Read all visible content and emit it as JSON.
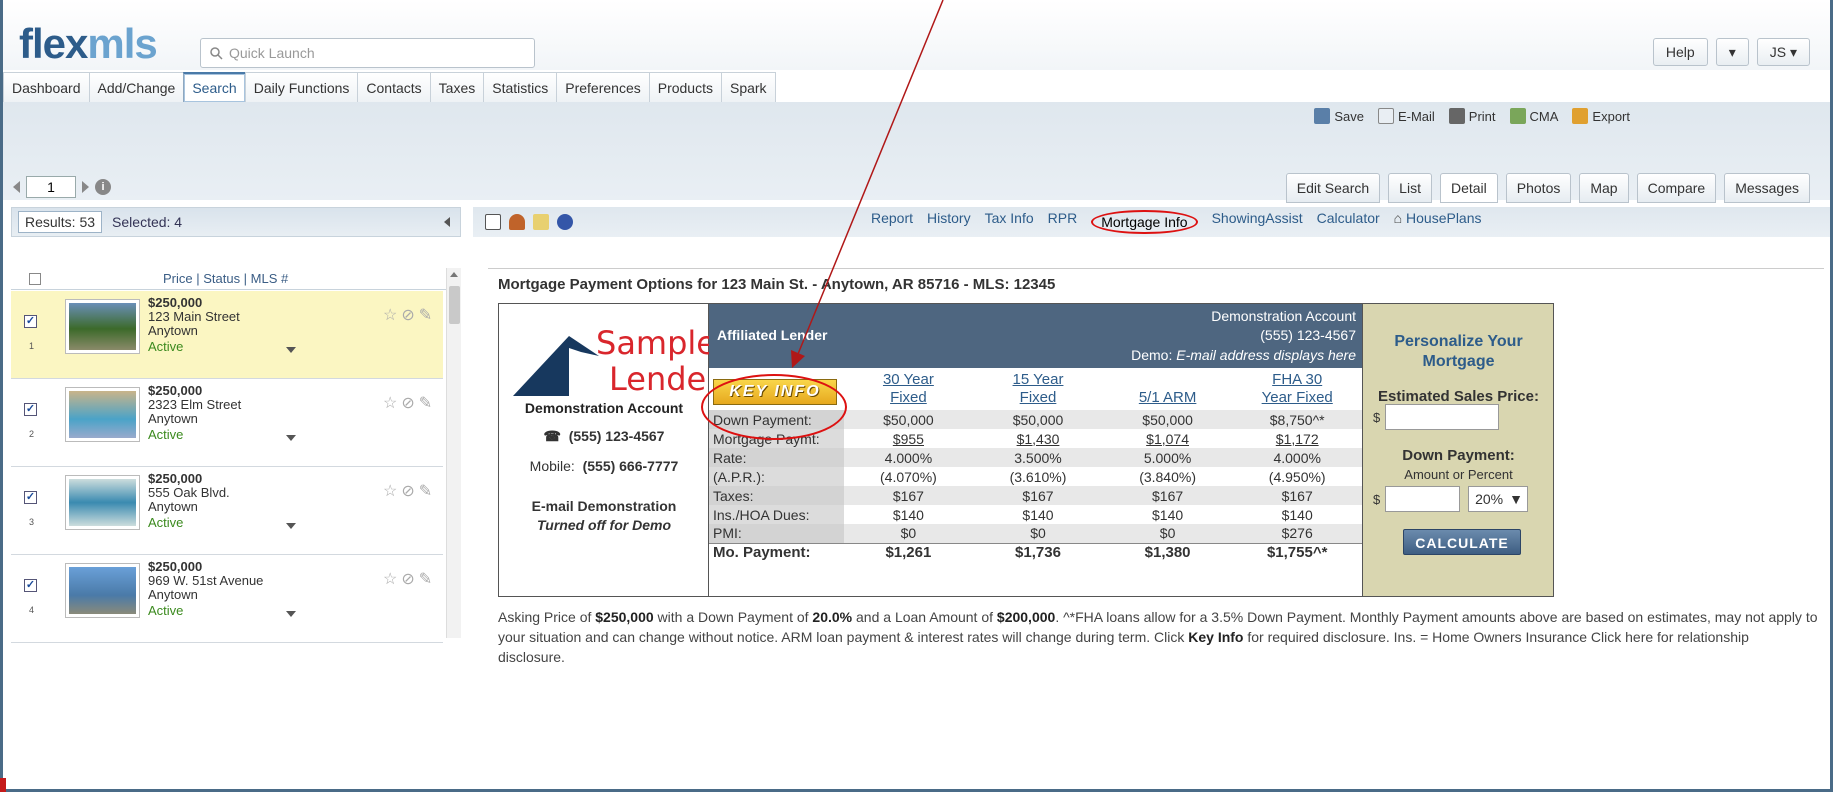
{
  "app": {
    "logo_part1": "flex",
    "logo_part2": "mls",
    "quick_launch_placeholder": "Quick Launch",
    "help_label": "Help",
    "user_label": "JS"
  },
  "nav": {
    "tabs": [
      "Dashboard",
      "Add/Change",
      "Search",
      "Daily Functions",
      "Contacts",
      "Taxes",
      "Statistics",
      "Preferences",
      "Products",
      "Spark"
    ],
    "active": "Search"
  },
  "actions": {
    "save": "Save",
    "email": "E-Mail",
    "print": "Print",
    "cma": "CMA",
    "export": "Export"
  },
  "pager": {
    "page": "1"
  },
  "view_tabs": [
    "Edit Search",
    "List",
    "Detail",
    "Photos",
    "Map",
    "Compare",
    "Messages"
  ],
  "results": {
    "count_label": "Results: 53",
    "selected_label": "Selected: 4"
  },
  "detail_links": [
    "Report",
    "History",
    "Tax Info",
    "RPR",
    "Mortgage Info",
    "ShowingAssist",
    "Calculator",
    "HousePlans"
  ],
  "list": {
    "header": "Price | Status | MLS #",
    "items": [
      {
        "num": "1",
        "price": "$250,000",
        "address": "123 Main Street",
        "city": "Anytown",
        "status": "Active"
      },
      {
        "num": "2",
        "price": "$250,000",
        "address": "2323 Elm Street",
        "city": "Anytown",
        "status": "Active"
      },
      {
        "num": "3",
        "price": "$250,000",
        "address": "555 Oak Blvd.",
        "city": "Anytown",
        "status": "Active"
      },
      {
        "num": "4",
        "price": "$250,000",
        "address": "969 W. 51st Avenue",
        "city": "Anytown",
        "status": "Active"
      }
    ]
  },
  "mortgage": {
    "title": "Mortgage Payment Options for 123 Main St. - Anytown, AR 85716 - MLS: 12345",
    "lender": {
      "name_line1": "Sample",
      "name_line2": "Lender",
      "account": "Demonstration Account",
      "phone": "(555) 123-4567",
      "mobile_label": "Mobile:",
      "mobile": "(555) 666-7777",
      "email_line": "E-mail Demonstration",
      "email_off": "Turned off for Demo"
    },
    "header": {
      "affiliated": "Affiliated Lender",
      "demo_account": "Demonstration Account",
      "demo_phone": "(555) 123-4567",
      "demo_prefix": "Demo:",
      "demo_email": "E-mail address displays here"
    },
    "key_info": "KEY INFO",
    "columns": [
      {
        "line1": "30 Year",
        "line2": "Fixed"
      },
      {
        "line1": "15 Year",
        "line2": "Fixed"
      },
      {
        "line1": "",
        "line2": "5/1 ARM"
      },
      {
        "line1": "FHA 30",
        "line2": "Year Fixed"
      }
    ],
    "rows": [
      {
        "label": "Down Payment:",
        "values": [
          "$50,000",
          "$50,000",
          "$50,000",
          "$8,750^*"
        ]
      },
      {
        "label": "Mortgage Paymt:",
        "values": [
          "$955",
          "$1,430",
          "$1,074",
          "$1,172"
        ],
        "underline": true
      },
      {
        "label": "Rate:",
        "values": [
          "4.000%",
          "3.500%",
          "5.000%",
          "4.000%"
        ]
      },
      {
        "label": "(A.P.R.):",
        "values": [
          "(4.070%)",
          "(3.610%)",
          "(3.840%)",
          "(4.950%)"
        ]
      },
      {
        "label": "Taxes:",
        "values": [
          "$167",
          "$167",
          "$167",
          "$167"
        ]
      },
      {
        "label": "Ins./HOA Dues:",
        "values": [
          "$140",
          "$140",
          "$140",
          "$140"
        ]
      },
      {
        "label": "PMI:",
        "values": [
          "$0",
          "$0",
          "$0",
          "$276"
        ]
      }
    ],
    "total": {
      "label": "Mo. Payment:",
      "values": [
        "$1,261",
        "$1,736",
        "$1,380",
        "$1,755^*"
      ]
    },
    "personalize": {
      "title_line1": "Personalize Your",
      "title_line2": "Mortgage",
      "est_label": "Estimated Sales Price:",
      "dollar": "$",
      "down_label": "Down Payment:",
      "amount_label": "Amount or Percent",
      "percent": "20%",
      "calculate": "CALCULATE"
    },
    "disclaimer": {
      "p1": "Asking Price of ",
      "asking": "$250,000",
      "p2": " with a Down Payment of ",
      "down": "20.0%",
      "p3": " and a Loan Amount of ",
      "loan": "$200,000",
      "p4": ". ^*FHA loans allow for a 3.5% Down Payment. Monthly Payment amounts above are based on estimates, may not apply to your situation and can change without notice. ARM loan payment & interest rates will change during term. Click ",
      "key": "Key Info",
      "p5": " for required disclosure. Ins. = Home Owners Insurance Click here for relationship disclosure."
    }
  },
  "colors": {
    "brand_dark": "#2d5c8a",
    "brand_light": "#6ba3cf",
    "lender_red": "#d9262c",
    "header_blue": "#4e6680",
    "active_green": "#3b8a1e",
    "annotation_red": "#c41a1a"
  }
}
